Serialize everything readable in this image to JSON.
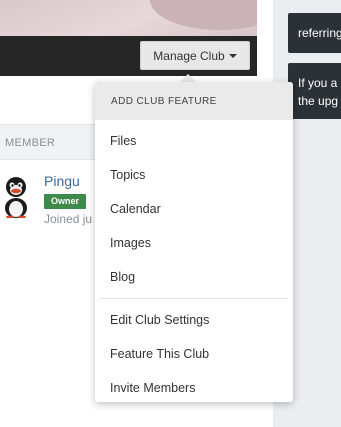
{
  "club": {
    "manage_label": "Manage Club"
  },
  "members": {
    "column_header": "MEMBER",
    "rows": [
      {
        "name": "Pingu",
        "badge": "Owner",
        "joined": "Joined ju"
      }
    ]
  },
  "dropdown": {
    "header": "ADD CLUB FEATURE",
    "features": [
      "Files",
      "Topics",
      "Calendar",
      "Images",
      "Blog"
    ],
    "actions": [
      "Edit Club Settings",
      "Feature This Club",
      "Invite Members"
    ]
  },
  "sidebar": {
    "notice1": "referring",
    "notice2_line1": "If you a",
    "notice2_line2": "the upg"
  }
}
